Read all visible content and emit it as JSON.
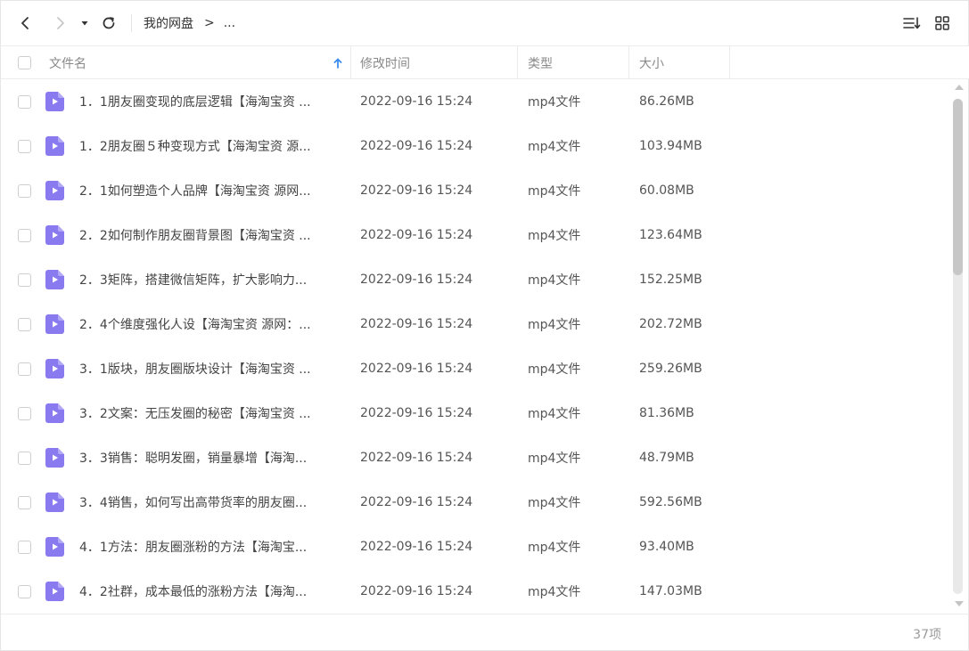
{
  "toolbar": {
    "breadcrumb_root": "我的网盘",
    "breadcrumb_separator": ">",
    "breadcrumb_more": "..."
  },
  "columns": {
    "name": "文件名",
    "time": "修改时间",
    "type": "类型",
    "size": "大小"
  },
  "colors": {
    "accent": "#3b8cf0",
    "file_icon": "#8a7af0"
  },
  "files": [
    {
      "name": "1．1朋友圈变现的底层逻辑【海淘宝资 ...",
      "time": "2022-09-16 15:24",
      "type": "mp4文件",
      "size": "86.26MB"
    },
    {
      "name": "1．2朋友圈５种变现方式【海淘宝资 源...",
      "time": "2022-09-16 15:24",
      "type": "mp4文件",
      "size": "103.94MB"
    },
    {
      "name": "2．1如何塑造个人品牌【海淘宝资 源网...",
      "time": "2022-09-16 15:24",
      "type": "mp4文件",
      "size": "60.08MB"
    },
    {
      "name": "2．2如何制作朋友圈背景图【海淘宝资 ...",
      "time": "2022-09-16 15:24",
      "type": "mp4文件",
      "size": "123.64MB"
    },
    {
      "name": "2．3矩阵，搭建微信矩阵，扩大影响力...",
      "time": "2022-09-16 15:24",
      "type": "mp4文件",
      "size": "152.25MB"
    },
    {
      "name": "2．4个维度强化人设【海淘宝资 源网：...",
      "time": "2022-09-16 15:24",
      "type": "mp4文件",
      "size": "202.72MB"
    },
    {
      "name": "3．1版块，朋友圈版块设计【海淘宝资 ...",
      "time": "2022-09-16 15:24",
      "type": "mp4文件",
      "size": "259.26MB"
    },
    {
      "name": "3．2文案：无压发圈的秘密【海淘宝资 ...",
      "time": "2022-09-16 15:24",
      "type": "mp4文件",
      "size": "81.36MB"
    },
    {
      "name": "3．3销售：聪明发圈，销量暴增【海淘...",
      "time": "2022-09-16 15:24",
      "type": "mp4文件",
      "size": "48.79MB"
    },
    {
      "name": "3．4销售，如何写出高带货率的朋友圈...",
      "time": "2022-09-16 15:24",
      "type": "mp4文件",
      "size": "592.56MB"
    },
    {
      "name": "4．1方法：朋友圈涨粉的方法【海淘宝...",
      "time": "2022-09-16 15:24",
      "type": "mp4文件",
      "size": "93.40MB"
    },
    {
      "name": "4．2社群，成本最低的涨粉方法【海淘...",
      "time": "2022-09-16 15:24",
      "type": "mp4文件",
      "size": "147.03MB"
    }
  ],
  "footer": {
    "item_count": "37项"
  }
}
